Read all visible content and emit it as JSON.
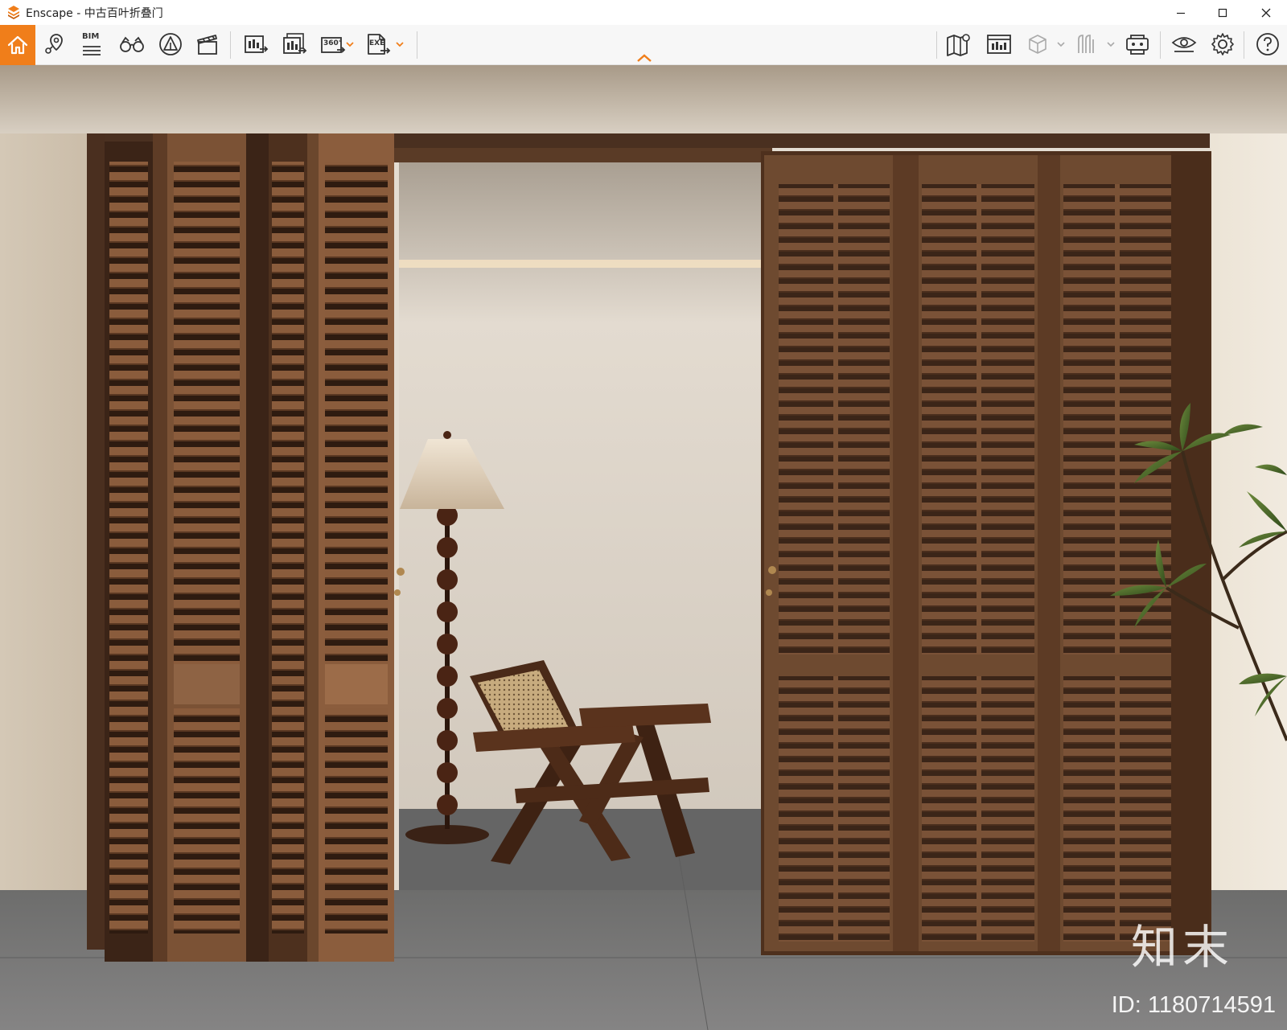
{
  "window": {
    "title": "Enscape - 中古百叶折叠门",
    "minimize_icon": "minimize-icon",
    "maximize_icon": "maximize-icon",
    "close_icon": "close-icon"
  },
  "toolbar": {
    "bim_label": "BIM",
    "pano_label": "360°",
    "exe_label": "EXE",
    "active_color": "#f07e1a",
    "left_icons": [
      "home-icon",
      "location-pin-icon",
      "bim-info-icon",
      "binoculars-icon",
      "asset-library-icon",
      "video-editor-icon",
      "screenshot-export-icon",
      "batch-render-icon",
      "panorama-360-icon",
      "exe-export-icon"
    ],
    "right_icons": [
      "map-icon",
      "capture-gallery-icon",
      "view-cube-icon",
      "section-icon",
      "vr-headset-icon",
      "visual-settings-icon",
      "settings-gear-icon",
      "help-icon"
    ]
  },
  "viewport": {
    "scene": "render-of-folding-louvered-doors",
    "watermark_brand": "知末",
    "watermark_id": "ID: 1180714591"
  }
}
